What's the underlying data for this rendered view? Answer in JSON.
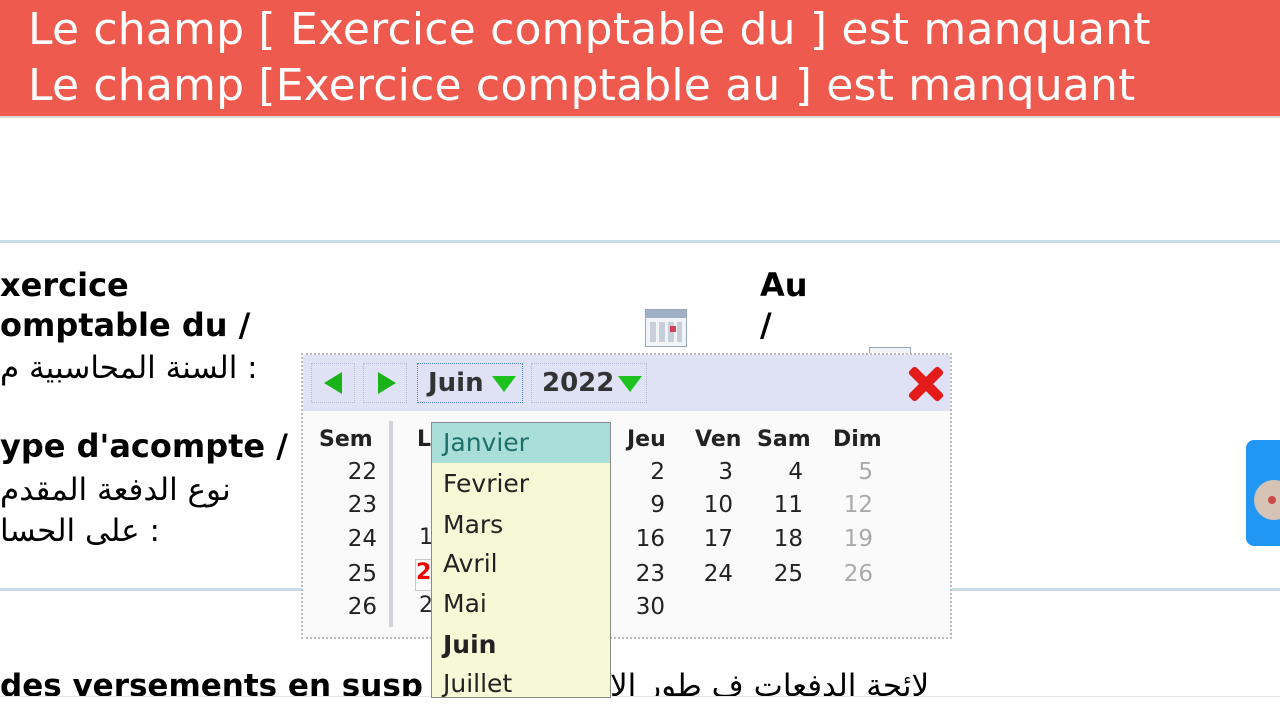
{
  "errors": {
    "line1": "Le champ [ Exercice comptable du ] est manquant",
    "line2": "Le champ [Exercice comptable au ] est manquant"
  },
  "form": {
    "exercice_line1": "xercice",
    "exercice_line2": "omptable du /",
    "exercice_ar": ": السنة المحاسبية م",
    "au_line1": "Au",
    "au_line2": "/",
    "type_label": "ype d'acompte /",
    "type_ar1": "نوع الدفعة المقدم",
    "type_ar2": ": على الحسا",
    "bottom_fr": "des versements en susp",
    "bottom_ar": "لائحة الدفعات ف طور الا"
  },
  "calendar": {
    "month": "Juin",
    "year": "2022",
    "headers": {
      "sem": "Sem",
      "lun": "L",
      "jeu": "Jeu",
      "ven": "Ven",
      "sam": "Sam",
      "dim": "Dim"
    },
    "weeks": [
      "22",
      "23",
      "24",
      "25",
      "26"
    ],
    "thu": [
      "2",
      "9",
      "16",
      "23",
      "30"
    ],
    "fri": [
      "3",
      "10",
      "17",
      "24"
    ],
    "sat": [
      "4",
      "11",
      "18",
      "25"
    ],
    "sun": [
      "5",
      "12",
      "19",
      "26"
    ],
    "today_partial": "2",
    "partial_row4": "2"
  },
  "months": [
    "Janvier",
    "Fevrier",
    "Mars",
    "Avril",
    "Mai",
    "Juin",
    "Juillet"
  ],
  "colors": {
    "error_banner": "#ee5a4e",
    "highlight": "#a9dfd8",
    "dropdown_bg": "#f7f8d5",
    "nav_arrow": "#19b319",
    "close": "#e31b1b"
  }
}
